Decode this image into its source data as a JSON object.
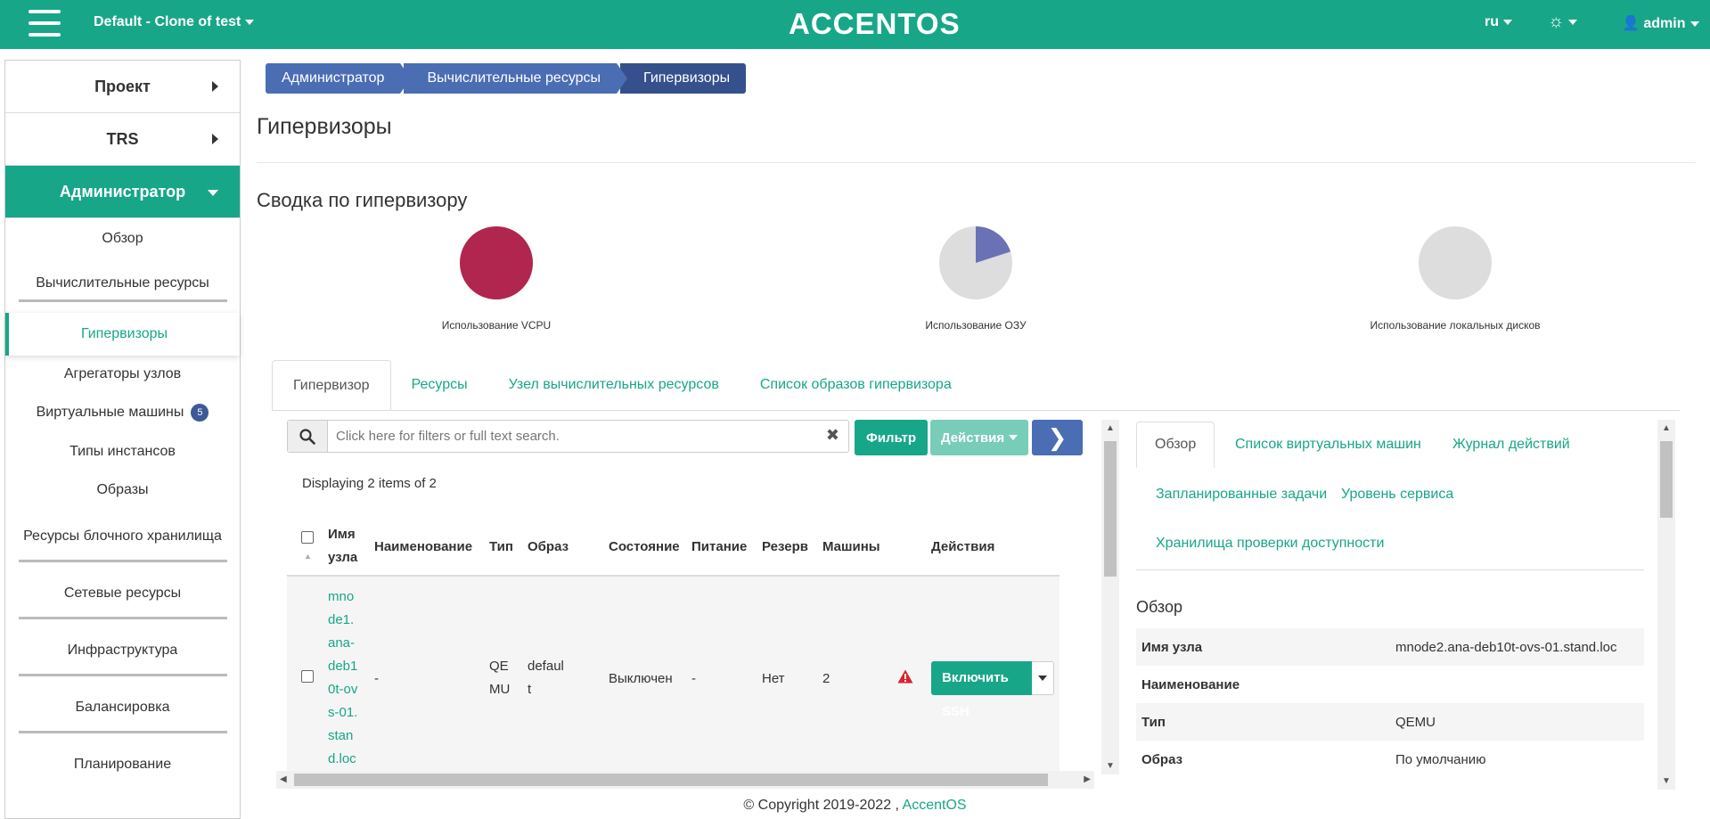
{
  "header": {
    "project": "Default - Clone of test",
    "logo": "ACCENTOS",
    "lang": "ru",
    "user": "admin"
  },
  "sidebar": {
    "groups": [
      "Проект",
      "TRS",
      "Администратор"
    ],
    "items": [
      "Обзор",
      "Вычислительные ресурсы",
      "Гипервизоры",
      "Агрегаторы узлов",
      "Виртуальные машины",
      "Типы инстансов",
      "Образы",
      "Ресурсы блочного хранилища",
      "Сетевые ресурсы",
      "Инфраструктура",
      "Балансировка",
      "Планирование"
    ],
    "vm_badge": "5"
  },
  "breadcrumb": [
    "Администратор",
    "Вычислительные ресурсы",
    "Гипервизоры"
  ],
  "page_title": "Гипервизоры",
  "summary": {
    "title": "Сводка по гипервизору",
    "charts": [
      {
        "label": "Использование VCPU",
        "used_fraction": 1.0,
        "color": "#b0264f"
      },
      {
        "label": "Использование ОЗУ",
        "used_fraction": 0.2,
        "color": "#6a72b5"
      },
      {
        "label": "Использование локальных дисков",
        "used_fraction": 0.0,
        "color": "#dddddd"
      }
    ]
  },
  "tabs": [
    "Гипервизор",
    "Ресурсы",
    "Узел вычислительных ресурсов",
    "Список образов гипервизора"
  ],
  "toolbar": {
    "search_placeholder": "Click here for filters or full text search.",
    "filter_label": "Фильтр",
    "actions_label": "Действия",
    "count_text": "Displaying 2 items of 2"
  },
  "table": {
    "headers": [
      "Имя узла",
      "Наименование",
      "Тип",
      "Образ",
      "Состояние",
      "Питание",
      "Резерв",
      "Машины",
      "Действия"
    ],
    "rows": [
      {
        "host": "mnode1.ana-deb10t-ovs-01.stand.loc",
        "name": "-",
        "type": "QEMU",
        "image": "default",
        "state": "Выключен",
        "power": "-",
        "reserve": "Нет",
        "machines": "2",
        "action": "Включить SSH"
      }
    ]
  },
  "detail": {
    "tabs": [
      "Обзор",
      "Список виртуальных машин",
      "Журнал действий",
      "Запланированные задачи",
      "Уровень сервиса",
      "Хранилища проверки доступности"
    ],
    "title": "Обзор",
    "rows": [
      {
        "k": "Имя узла",
        "v": "mnode2.ana-deb10t-ovs-01.stand.loc"
      },
      {
        "k": "Наименование",
        "v": ""
      },
      {
        "k": "Тип",
        "v": "QEMU"
      },
      {
        "k": "Образ",
        "v": "По умолчанию"
      }
    ]
  },
  "footer": {
    "copyright": "© Copyright 2019-2022 ,",
    "link": "AccentOS"
  }
}
